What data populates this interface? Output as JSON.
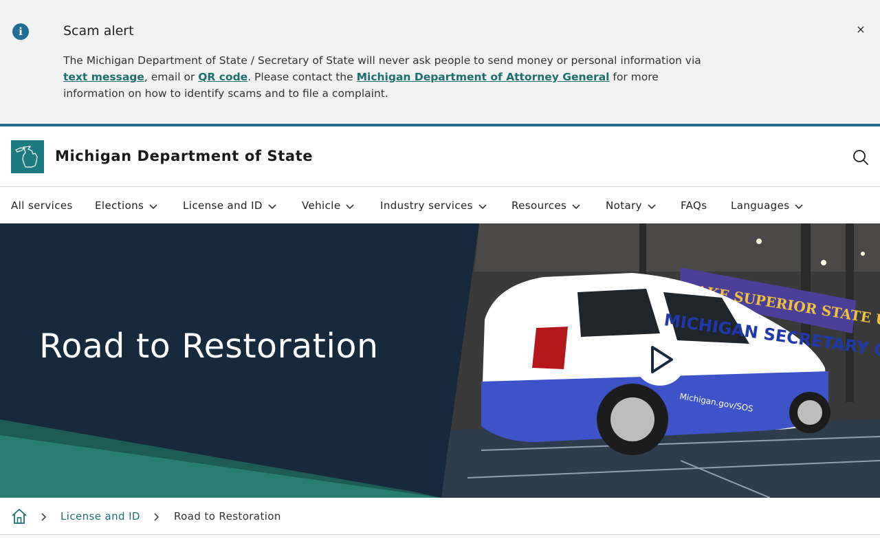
{
  "alert": {
    "title": "Scam alert",
    "body_part1": "The Michigan Department of State / Secretary of State will never ask people to send money or personal information via ",
    "link_text_message": "text message",
    "body_part2": ", email or ",
    "link_qr_code": "QR code",
    "body_part3": ". Please contact the ",
    "link_attorney_general": "Michigan Department of Attorney General",
    "body_part4": " for more information on how to identify scams and to file a complaint.",
    "close_glyph": "×",
    "icon": "info-icon"
  },
  "header": {
    "site_title": "Michigan Department of State",
    "logo": "michigan-map-logo",
    "search_icon": "search-icon"
  },
  "nav": {
    "items": [
      {
        "label": "All services",
        "dropdown": false
      },
      {
        "label": "Elections",
        "dropdown": true
      },
      {
        "label": "License and ID",
        "dropdown": true
      },
      {
        "label": "Vehicle",
        "dropdown": true
      },
      {
        "label": "Industry services",
        "dropdown": true
      },
      {
        "label": "Resources",
        "dropdown": true
      },
      {
        "label": "Notary",
        "dropdown": true
      },
      {
        "label": "FAQs",
        "dropdown": false
      },
      {
        "label": "Languages",
        "dropdown": true
      }
    ]
  },
  "hero": {
    "title": "Road to Restoration",
    "play_icon": "play-icon",
    "photo_banner_text": "LAKE SUPERIOR STATE UNIVERSITY",
    "van_text_main": "MICHIGAN SECRETARY OF STATE",
    "van_text_url": "Michigan.gov/SOS"
  },
  "breadcrumb": {
    "home_icon": "home-icon",
    "link": "License and ID",
    "current": "Road to Restoration"
  },
  "colors": {
    "alert_bg": "#f2f2f2",
    "info_blue": "#1f6e98",
    "link_teal": "#1d6e6e",
    "header_rule": "#1f6e8f",
    "logo_teal": "#1e7a82",
    "hero_navy": "#16293d",
    "hero_green": "#2a7d72"
  }
}
